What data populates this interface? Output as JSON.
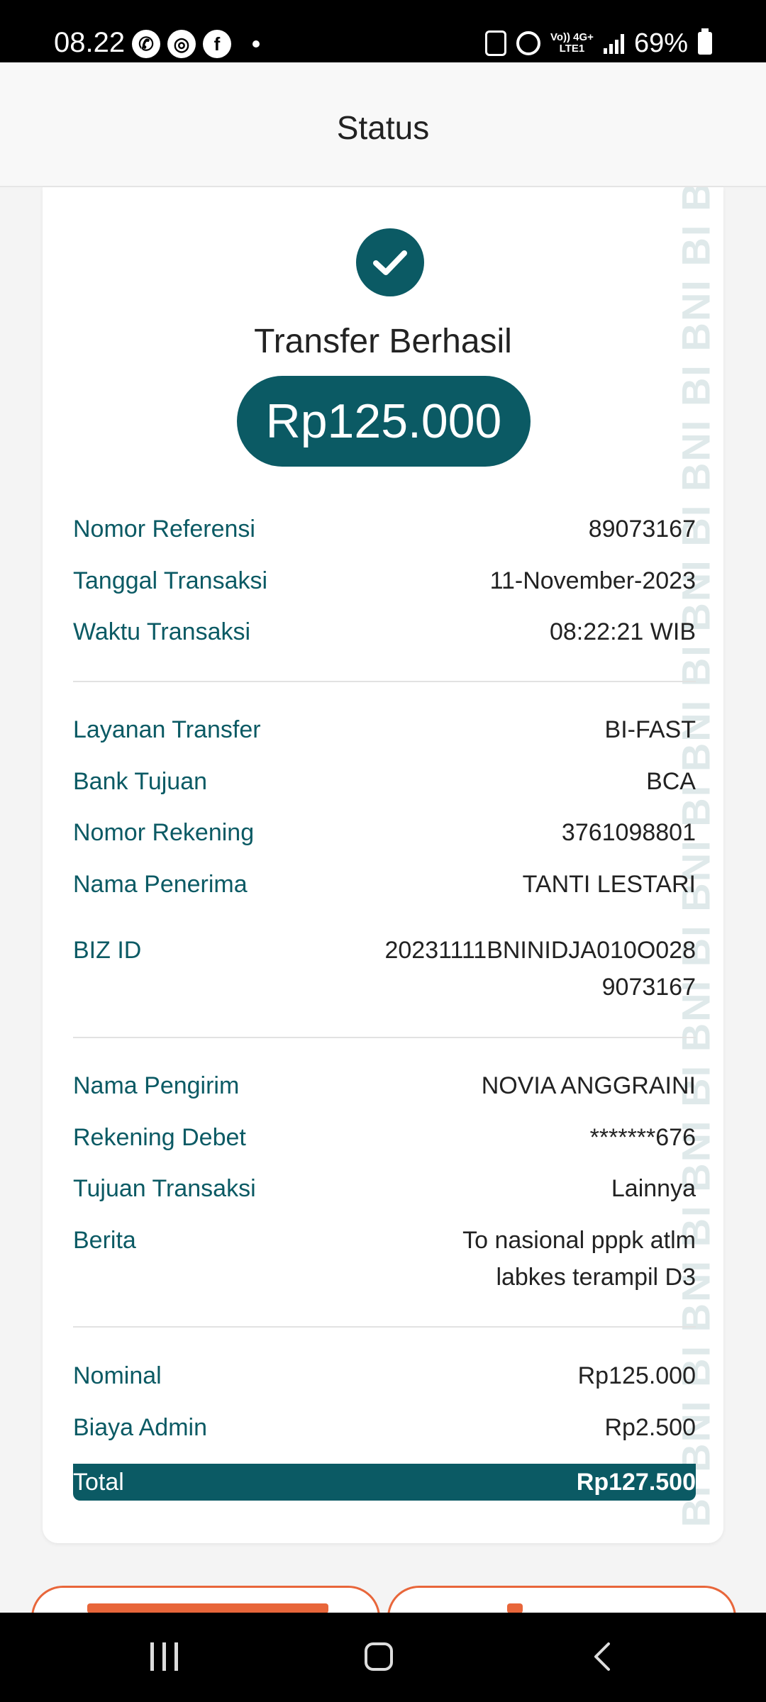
{
  "status_bar": {
    "time": "08.22",
    "network_line1": "Vo)) 4G+",
    "network_line2": "LTE1",
    "battery": "69%"
  },
  "header": {
    "title": "Status"
  },
  "result": {
    "title": "Transfer Berhasil",
    "amount": "Rp125.000"
  },
  "details": {
    "nomor_referensi": {
      "label": "Nomor Referensi",
      "value": "89073167"
    },
    "tanggal_transaksi": {
      "label": "Tanggal Transaksi",
      "value": "11-November-2023"
    },
    "waktu_transaksi": {
      "label": "Waktu Transaksi",
      "value": "08:22:21 WIB"
    },
    "layanan_transfer": {
      "label": "Layanan Transfer",
      "value": "BI-FAST"
    },
    "bank_tujuan": {
      "label": "Bank Tujuan",
      "value": "BCA"
    },
    "nomor_rekening": {
      "label": "Nomor Rekening",
      "value": "3761098801"
    },
    "nama_penerima": {
      "label": "Nama Penerima",
      "value": "TANTI LESTARI"
    },
    "biz_id": {
      "label": "BIZ ID",
      "value_line1": "20231111BNINIDJA010O028",
      "value_line2": "9073167"
    },
    "nama_pengirim": {
      "label": "Nama Pengirim",
      "value": "NOVIA ANGGRAINI"
    },
    "rekening_debet": {
      "label": "Rekening Debet",
      "value": "*******676"
    },
    "tujuan_transaksi": {
      "label": "Tujuan Transaksi",
      "value": "Lainnya"
    },
    "berita": {
      "label": "Berita",
      "value_line1": "To nasional pppk atlm",
      "value_line2": "labkes terampil D3"
    },
    "nominal": {
      "label": "Nominal",
      "value": "Rp125.000"
    },
    "biaya_admin": {
      "label": "Biaya Admin",
      "value": "Rp2.500"
    },
    "total": {
      "label": "Total",
      "value": "Rp127.500"
    }
  },
  "watermark": "BNI BI BNI BI BNI BI BNI BI BNI BI BNI BI BNI BI BNI BI BNI BI BNI BI BNI",
  "colors": {
    "primary": "#0b5a64",
    "accent": "#e8663a",
    "label_text": "#0b5a64"
  }
}
